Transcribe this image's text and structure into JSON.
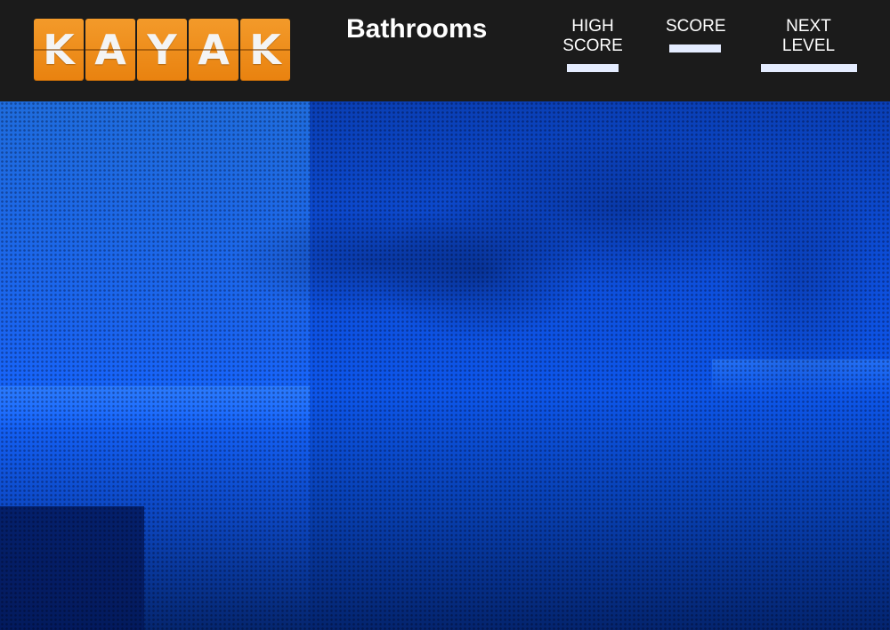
{
  "header": {
    "logo_letters": [
      "K",
      "A",
      "Y",
      "A",
      "K"
    ],
    "level_title": "Bathrooms",
    "stats": {
      "high_score_label": "HIGH SCORE",
      "score_label": "SCORE",
      "next_level_label": "NEXT LEVEL"
    }
  },
  "colors": {
    "header_bg": "#1b1b1b",
    "logo_orange": "#f0901e",
    "scene_blue": "#0d56ea",
    "bar_fill": "#e4ecff"
  }
}
